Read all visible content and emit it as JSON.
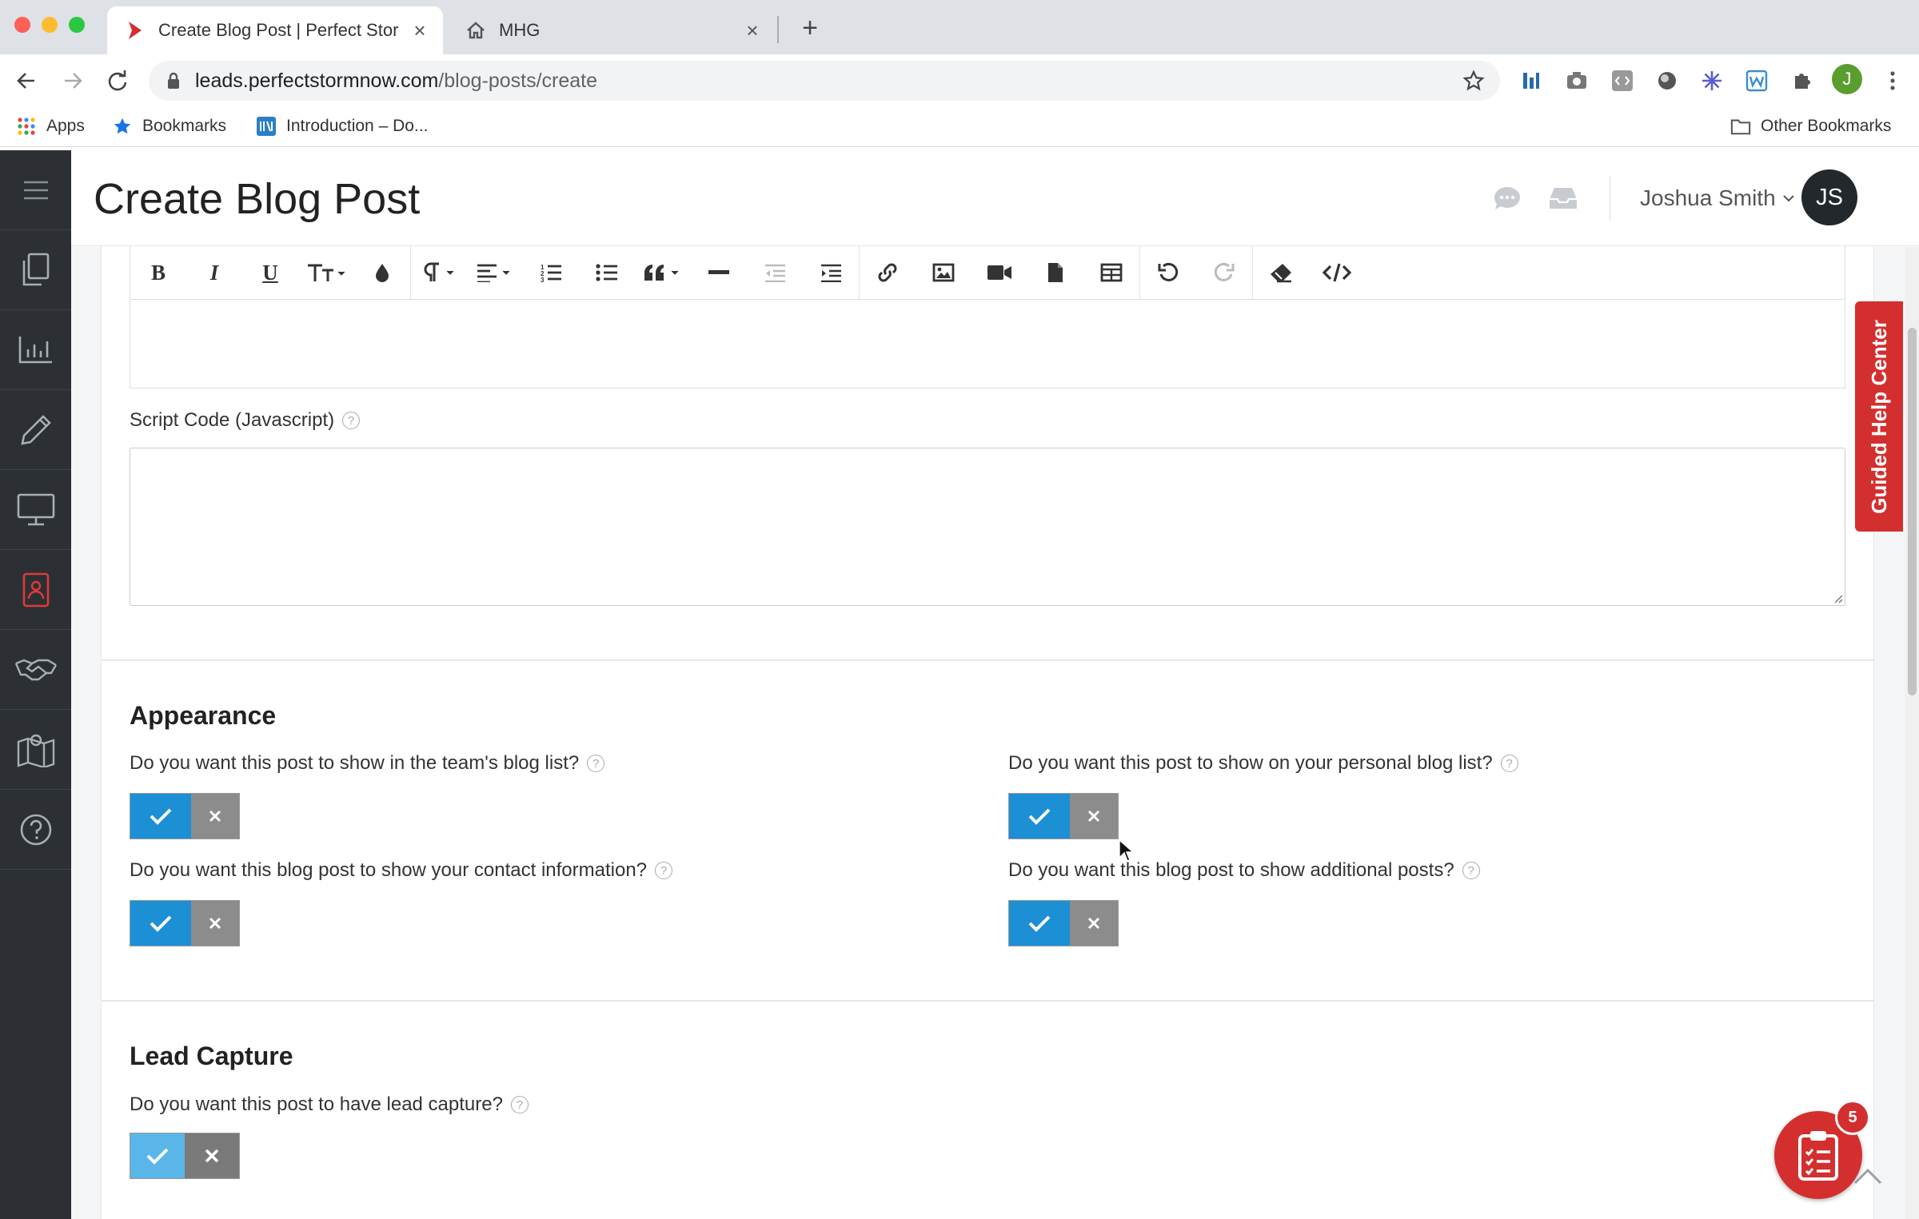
{
  "browser": {
    "tabs": [
      {
        "title": "Create Blog Post | Perfect Stor",
        "active": true
      },
      {
        "title": "MHG",
        "active": false
      }
    ],
    "url_host": "leads.perfectstormnow.com",
    "url_path": "/blog-posts/create",
    "profile_initial": "J",
    "bookmarks": {
      "apps": "Apps",
      "bookmarks": "Bookmarks",
      "intro": "Introduction – Do...",
      "other": "Other Bookmarks"
    }
  },
  "header": {
    "title": "Create Blog Post",
    "user_name": "Joshua Smith",
    "avatar_initials": "JS"
  },
  "sidebar": {
    "items": [
      "menu-icon",
      "pages-icon",
      "chart-icon",
      "pencil-icon",
      "monitor-icon",
      "contact-icon",
      "handshake-icon",
      "map-icon",
      "help-icon"
    ]
  },
  "editor": {
    "toolbar": [
      "bold",
      "italic",
      "underline",
      "font-size",
      "color",
      "paragraph",
      "align",
      "ordered-list",
      "unordered-list",
      "quote",
      "horizontal-rule",
      "outdent",
      "indent",
      "link",
      "image",
      "video",
      "file",
      "table",
      "undo",
      "redo",
      "eraser",
      "code-view"
    ],
    "script_label": "Script Code (Javascript)"
  },
  "appearance": {
    "title": "Appearance",
    "q_team_list": "Do you want this post to show in the team's blog list?",
    "q_personal_list": "Do you want this post to show on your personal blog list?",
    "q_contact_info": "Do you want this blog post to show your contact information?",
    "q_additional_posts": "Do you want this blog post to show additional posts?"
  },
  "lead_capture": {
    "title": "Lead Capture",
    "q_lead_capture": "Do you want this post to have lead capture?"
  },
  "help_center": {
    "label": "Guided Help Center"
  },
  "fab": {
    "badge_count": "5"
  },
  "colors": {
    "sidebar_bg": "#2c3034",
    "accent_blue": "#1d8fd4",
    "toggle_off": "#8c8c8c",
    "brand_red": "#d32f2f"
  }
}
